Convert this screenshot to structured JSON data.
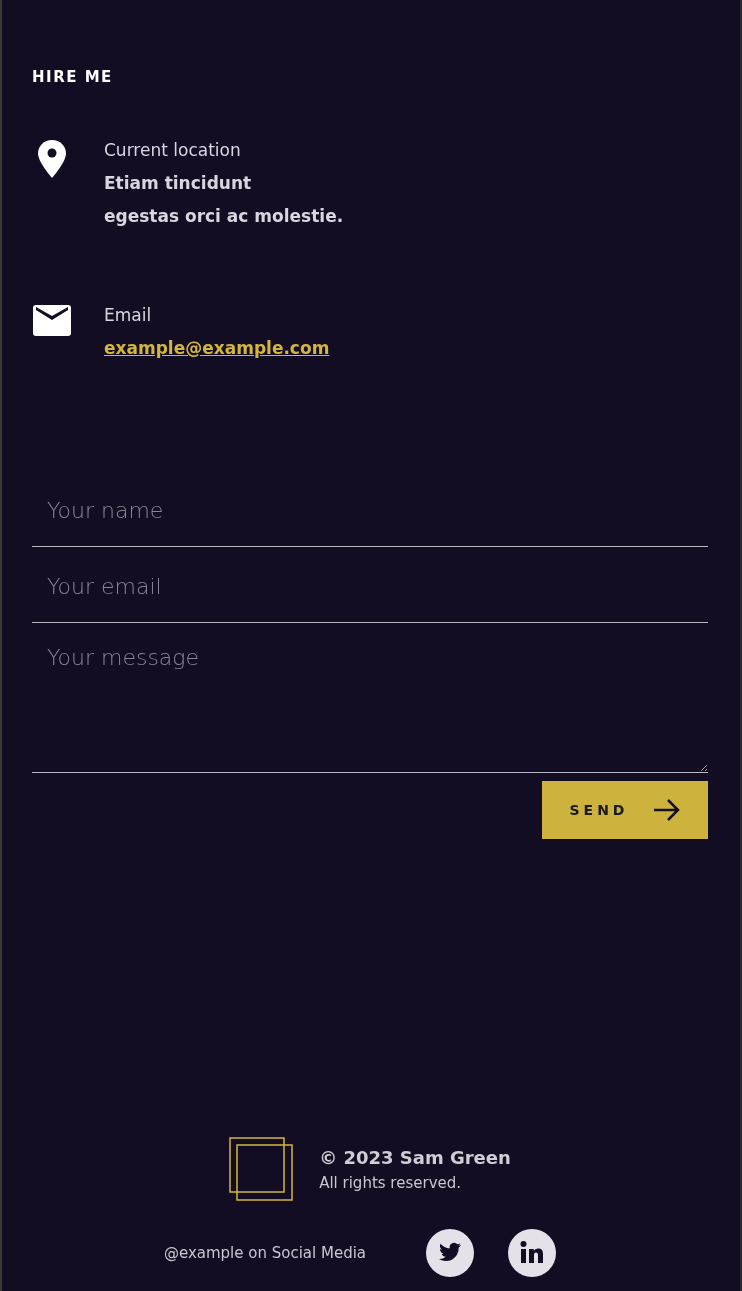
{
  "section_title": "HIRE ME",
  "contacts": [
    {
      "kind": "location",
      "label": "Current location",
      "lines": [
        "Etiam tincidunt",
        "egestas orci ac molestie."
      ]
    },
    {
      "kind": "email",
      "label": "Email",
      "link": "example@example.com"
    }
  ],
  "form": {
    "fields": [
      {
        "kind": "text",
        "placeholder": "Your name"
      },
      {
        "kind": "text",
        "placeholder": "Your email"
      },
      {
        "kind": "textarea",
        "placeholder": "Your message"
      }
    ],
    "button": "SEND"
  },
  "footer": {
    "copyright": "© 2023 Sam Green",
    "rights": "All rights reserved.",
    "social_text": "@example on Social Media",
    "social": [
      {
        "kind": "twitter"
      },
      {
        "kind": "linkedin"
      }
    ]
  }
}
